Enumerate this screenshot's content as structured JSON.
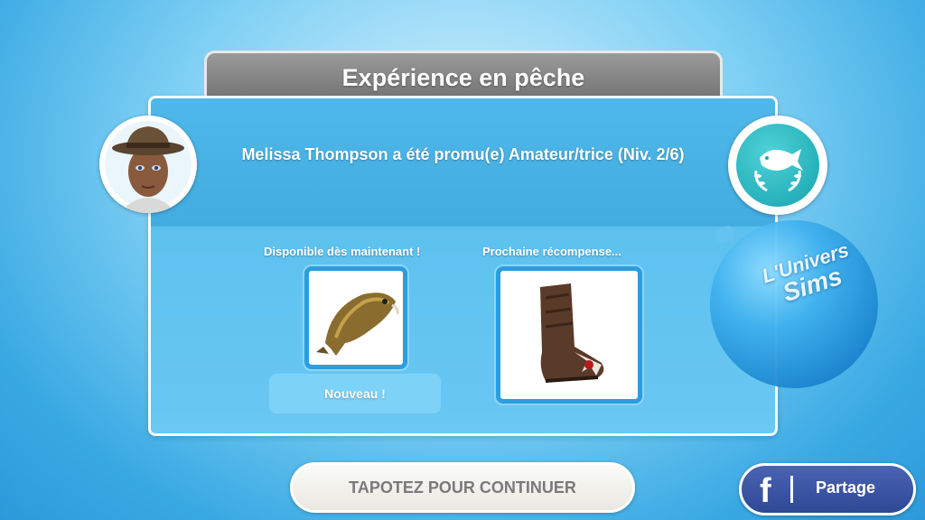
{
  "title": "Expérience en pêche",
  "promotion_text": "Melissa Thompson a été promu(e) Amateur/trice (Niv. 2/6)",
  "rewards": {
    "available_label": "Disponible dès maintenant !",
    "next_label": "Prochaine récompense...",
    "available_item_icon": "fish-icon",
    "next_item_icon": "boot-icon",
    "new_badge": "Nouveau !"
  },
  "orb_logo": {
    "line1": "L'Univers",
    "line2": "Sims"
  },
  "buttons": {
    "continue": "TAPOTEZ POUR CONTINUER",
    "share": "Partage",
    "share_brand_glyph": "f"
  },
  "colors": {
    "panel_blue": "#43acdf",
    "title_grey": "#7f7f7f",
    "facebook_blue": "#3b5aa6",
    "medal_teal": "#1aa7b0"
  }
}
